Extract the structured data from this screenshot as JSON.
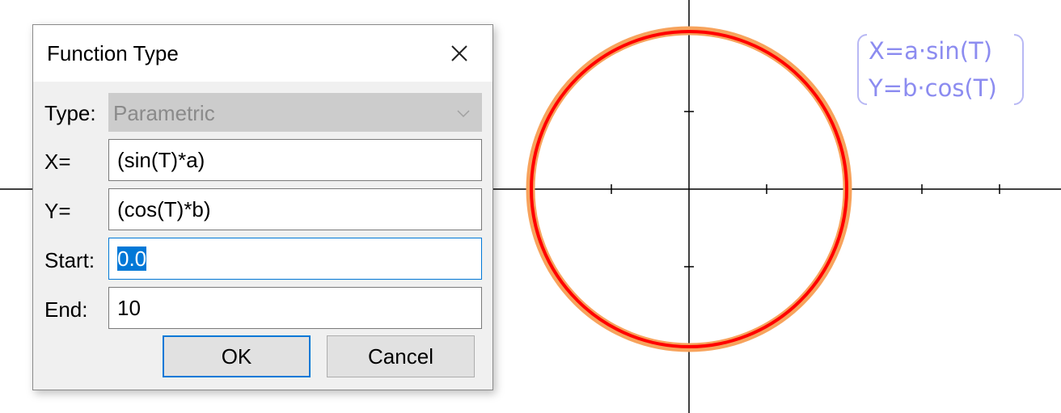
{
  "graph": {
    "formula_x": "X=a·sin(T)",
    "formula_y": "Y=b·cos(T)",
    "curve_colors": {
      "outer": "#f7a35c",
      "inner": "#ff0000"
    },
    "formula_color": "#8c8cf0"
  },
  "dialog": {
    "title": "Function Type",
    "close_icon": "close-icon",
    "type_label": "Type:",
    "type_value": "Parametric",
    "x_label": "X=",
    "x_value": "(sin(T)*a)",
    "y_label": "Y=",
    "y_value": "(cos(T)*b)",
    "start_label": "Start:",
    "start_value": "0.0",
    "end_label": "End:",
    "end_value": "10",
    "ok_label": "OK",
    "cancel_label": "Cancel"
  }
}
